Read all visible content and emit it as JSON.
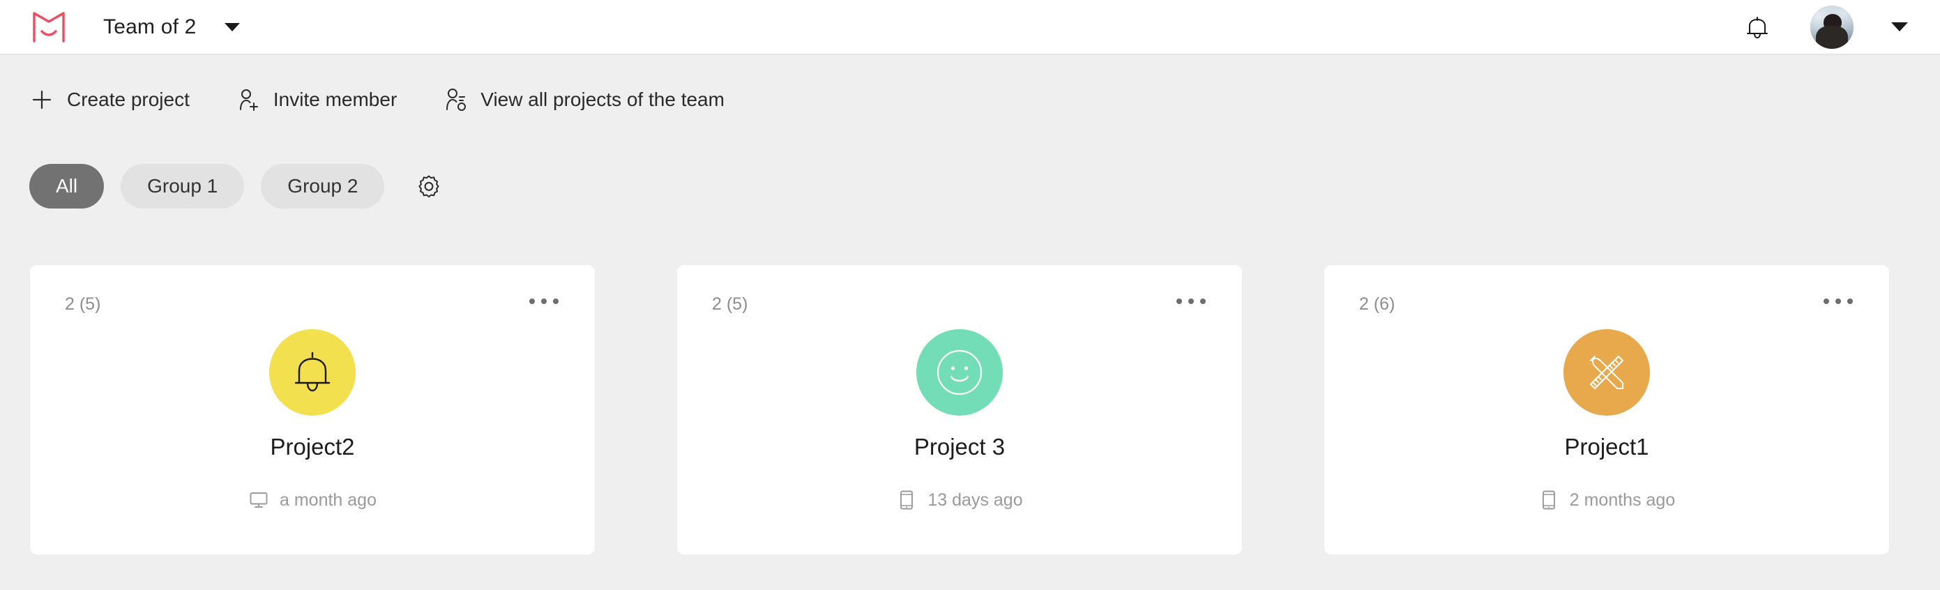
{
  "topbar": {
    "logo_icon": "marvel-logo-icon",
    "logo_color": "#eb4d63",
    "team_name": "Team of 2",
    "team_caret_icon": "chevron-down-icon",
    "notifications_icon": "bell-icon",
    "avatar_icon": "user-avatar",
    "account_caret_icon": "chevron-down-icon"
  },
  "actions": [
    {
      "label": "Create project",
      "icon": "plus-icon"
    },
    {
      "label": "Invite member",
      "icon": "person-plus-icon"
    },
    {
      "label": "View all projects of the team",
      "icon": "person-list-icon"
    }
  ],
  "tabs": {
    "items": [
      {
        "label": "All",
        "active": true
      },
      {
        "label": "Group 1",
        "active": false
      },
      {
        "label": "Group 2",
        "active": false
      }
    ],
    "settings_icon": "gear-icon",
    "active_bg": "#727272",
    "inactive_bg": "#e2e2e2"
  },
  "cards": [
    {
      "count": "2 (5)",
      "title": "Project2",
      "time": "a month ago",
      "device_icon": "desktop-icon",
      "avatar_icon": "bell-icon",
      "avatar_color": "#f3e04f",
      "menu_icon": "ellipsis-icon"
    },
    {
      "count": "2 (5)",
      "title": "Project 3",
      "time": "13 days ago",
      "device_icon": "mobile-icon",
      "avatar_icon": "smiley-icon",
      "avatar_color": "#72ddb6",
      "menu_icon": "ellipsis-icon"
    },
    {
      "count": "2 (6)",
      "title": "Project1",
      "time": "2 months ago",
      "device_icon": "mobile-icon",
      "avatar_icon": "pencil-ruler-icon",
      "avatar_color": "#e8a84c",
      "menu_icon": "ellipsis-icon"
    }
  ],
  "theme": {
    "page_bg": "#efefef",
    "card_bg": "#ffffff",
    "topbar_bg": "#ffffff"
  }
}
